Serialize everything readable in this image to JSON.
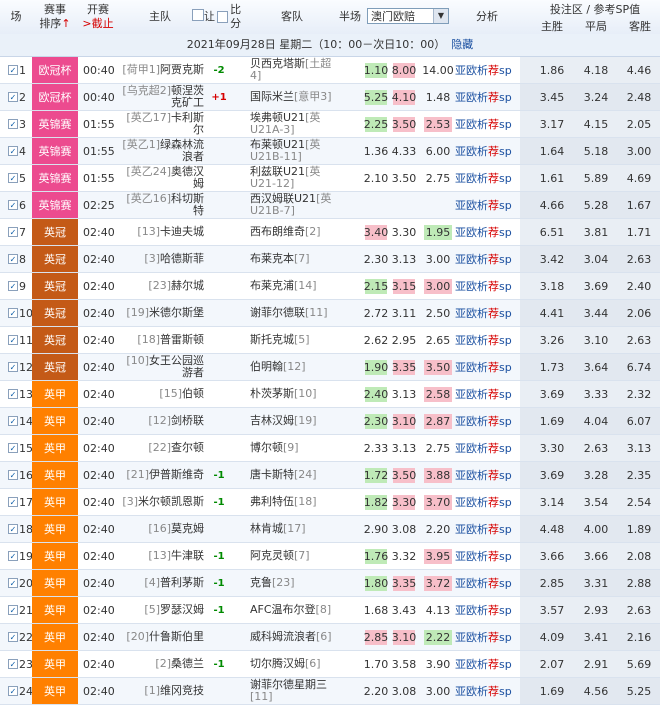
{
  "header": {
    "col_field": "场",
    "col_event": "赛事",
    "col_sort": "排序",
    "sort_arrow": "↑",
    "col_kick": "开赛",
    "col_cutoff": ">截止",
    "col_home": "主队",
    "col_hcap_let": "让",
    "col_hcap_score": "比分",
    "col_away": "客队",
    "col_half": "半场",
    "half_select": "澳门欧赔",
    "col_analysis": "分析",
    "sp_title": "投注区 / 参考SP值",
    "sp_home": "主胜",
    "sp_draw": "平局",
    "sp_away": "客胜"
  },
  "datebar": {
    "text": "2021年09月28日 星期二（10：00－次日10：00）",
    "hide_link": "隐藏"
  },
  "colors": {
    "ucl": "#ec4b8f",
    "champ": "#c45a17",
    "l1": "#ff8000",
    "odds_green": "#bfeab7",
    "odds_pink": "#f7bfc9"
  },
  "link_labels": {
    "yp": "亚",
    "op": "欧",
    "xi": "析",
    "tj": "荐",
    "sp": "sp"
  },
  "matches": [
    {
      "no": "1",
      "league": "欧冠杯",
      "lc": "ucl",
      "time": "00:40",
      "home_rank": "[荷甲1]",
      "home": "阿贾克斯",
      "hc": "-2",
      "hcc": "green",
      "away": "贝西克塔斯",
      "away_rank": "[土超4]",
      "o1": "1.10",
      "o1c": "g",
      "o2": "8.00",
      "o2c": "p",
      "o3": "14.00",
      "o3c": "",
      "sp1": "1.86",
      "sp2": "4.18",
      "sp3": "4.46"
    },
    {
      "no": "2",
      "league": "欧冠杯",
      "lc": "ucl",
      "time": "00:40",
      "home_rank": "[乌克超2]",
      "home": "顿涅茨克矿工",
      "hc": "+1",
      "hcc": "red",
      "away": "国际米兰",
      "away_rank": "[意甲3]",
      "o1": "5.25",
      "o1c": "g",
      "o2": "4.10",
      "o2c": "p",
      "o3": "1.48",
      "o3c": "",
      "sp1": "3.45",
      "sp2": "3.24",
      "sp3": "2.48"
    },
    {
      "no": "3",
      "league": "英锦赛",
      "lc": "ucl",
      "time": "01:55",
      "home_rank": "[英乙17]",
      "home": "卡利斯尔",
      "hc": "",
      "hcc": "",
      "away": "埃弗顿U21",
      "away_rank": "[英U21A-3]",
      "o1": "2.25",
      "o1c": "g",
      "o2": "3.50",
      "o2c": "p",
      "o3": "2.53",
      "o3c": "p",
      "sp1": "3.17",
      "sp2": "4.15",
      "sp3": "2.05"
    },
    {
      "no": "4",
      "league": "英锦赛",
      "lc": "ucl",
      "time": "01:55",
      "home_rank": "[英乙1]",
      "home": "绿森林流浪者",
      "hc": "",
      "hcc": "",
      "away": "布莱顿U21",
      "away_rank": "[英U21B-11]",
      "o1": "1.36",
      "o1c": "",
      "o2": "4.33",
      "o2c": "",
      "o3": "6.00",
      "o3c": "",
      "sp1": "1.64",
      "sp2": "5.18",
      "sp3": "3.00"
    },
    {
      "no": "5",
      "league": "英锦赛",
      "lc": "ucl",
      "time": "01:55",
      "home_rank": "[英乙24]",
      "home": "奥德汉姆",
      "hc": "",
      "hcc": "",
      "away": "利兹联U21",
      "away_rank": "[英U21-12]",
      "o1": "2.10",
      "o1c": "",
      "o2": "3.50",
      "o2c": "",
      "o3": "2.75",
      "o3c": "",
      "sp1": "1.61",
      "sp2": "5.89",
      "sp3": "4.69"
    },
    {
      "no": "6",
      "league": "英锦赛",
      "lc": "ucl",
      "time": "02:25",
      "home_rank": "[英乙16]",
      "home": "科切斯特",
      "hc": "",
      "hcc": "",
      "away": "西汉姆联U21",
      "away_rank": "[英U21B-7]",
      "o1": "",
      "o1c": "",
      "o2": "",
      "o2c": "",
      "o3": "",
      "o3c": "",
      "sp1": "4.66",
      "sp2": "5.28",
      "sp3": "1.67"
    },
    {
      "no": "7",
      "league": "英冠",
      "lc": "champ",
      "time": "02:40",
      "home_rank": "[13]",
      "home": "卡迪夫城",
      "hc": "",
      "hcc": "",
      "away": "西布朗维奇",
      "away_rank": "[2]",
      "o1": "3.40",
      "o1c": "p",
      "o2": "3.30",
      "o2c": "",
      "o3": "1.95",
      "o3c": "g",
      "sp1": "6.51",
      "sp2": "3.81",
      "sp3": "1.71"
    },
    {
      "no": "8",
      "league": "英冠",
      "lc": "champ",
      "time": "02:40",
      "home_rank": "[3]",
      "home": "哈德斯菲",
      "hc": "",
      "hcc": "",
      "away": "布莱克本",
      "away_rank": "[7]",
      "o1": "2.30",
      "o1c": "",
      "o2": "3.13",
      "o2c": "",
      "o3": "3.00",
      "o3c": "",
      "sp1": "3.42",
      "sp2": "3.04",
      "sp3": "2.63"
    },
    {
      "no": "9",
      "league": "英冠",
      "lc": "champ",
      "time": "02:40",
      "home_rank": "[23]",
      "home": "赫尔城",
      "hc": "",
      "hcc": "",
      "away": "布莱克浦",
      "away_rank": "[14]",
      "o1": "2.15",
      "o1c": "g",
      "o2": "3.15",
      "o2c": "p",
      "o3": "3.00",
      "o3c": "p",
      "sp1": "3.18",
      "sp2": "3.69",
      "sp3": "2.40"
    },
    {
      "no": "10",
      "league": "英冠",
      "lc": "champ",
      "time": "02:40",
      "home_rank": "[19]",
      "home": "米德尔斯堡",
      "hc": "",
      "hcc": "",
      "away": "谢菲尔德联",
      "away_rank": "[11]",
      "o1": "2.72",
      "o1c": "",
      "o2": "3.11",
      "o2c": "",
      "o3": "2.50",
      "o3c": "",
      "sp1": "4.41",
      "sp2": "3.44",
      "sp3": "2.06"
    },
    {
      "no": "11",
      "league": "英冠",
      "lc": "champ",
      "time": "02:40",
      "home_rank": "[18]",
      "home": "普雷斯顿",
      "hc": "",
      "hcc": "",
      "away": "斯托克城",
      "away_rank": "[5]",
      "o1": "2.62",
      "o1c": "",
      "o2": "2.95",
      "o2c": "",
      "o3": "2.65",
      "o3c": "",
      "sp1": "3.26",
      "sp2": "3.10",
      "sp3": "2.63"
    },
    {
      "no": "12",
      "league": "英冠",
      "lc": "champ",
      "time": "02:40",
      "home_rank": "[10]",
      "home": "女王公园巡游者",
      "hc": "",
      "hcc": "",
      "away": "伯明翰",
      "away_rank": "[12]",
      "o1": "1.90",
      "o1c": "g",
      "o2": "3.35",
      "o2c": "p",
      "o3": "3.50",
      "o3c": "p",
      "sp1": "1.73",
      "sp2": "3.64",
      "sp3": "6.74"
    },
    {
      "no": "13",
      "league": "英甲",
      "lc": "l1",
      "time": "02:40",
      "home_rank": "[15]",
      "home": "伯顿",
      "hc": "",
      "hcc": "",
      "away": "朴茨茅斯",
      "away_rank": "[10]",
      "o1": "2.40",
      "o1c": "g",
      "o2": "3.13",
      "o2c": "",
      "o3": "2.58",
      "o3c": "p",
      "sp1": "3.69",
      "sp2": "3.33",
      "sp3": "2.32"
    },
    {
      "no": "14",
      "league": "英甲",
      "lc": "l1",
      "time": "02:40",
      "home_rank": "[12]",
      "home": "剑桥联",
      "hc": "",
      "hcc": "",
      "away": "吉林汉姆",
      "away_rank": "[19]",
      "o1": "2.30",
      "o1c": "g",
      "o2": "3.10",
      "o2c": "p",
      "o3": "2.87",
      "o3c": "p",
      "sp1": "1.69",
      "sp2": "4.04",
      "sp3": "6.07"
    },
    {
      "no": "15",
      "league": "英甲",
      "lc": "l1",
      "time": "02:40",
      "home_rank": "[22]",
      "home": "查尔顿",
      "hc": "",
      "hcc": "",
      "away": "博尔顿",
      "away_rank": "[9]",
      "o1": "2.33",
      "o1c": "",
      "o2": "3.13",
      "o2c": "",
      "o3": "2.75",
      "o3c": "",
      "sp1": "3.30",
      "sp2": "2.63",
      "sp3": "3.13"
    },
    {
      "no": "16",
      "league": "英甲",
      "lc": "l1",
      "time": "02:40",
      "home_rank": "[21]",
      "home": "伊普斯维奇",
      "hc": "-1",
      "hcc": "green",
      "away": "唐卡斯特",
      "away_rank": "[24]",
      "o1": "1.72",
      "o1c": "g",
      "o2": "3.50",
      "o2c": "p",
      "o3": "3.88",
      "o3c": "p",
      "sp1": "3.69",
      "sp2": "3.28",
      "sp3": "2.35"
    },
    {
      "no": "17",
      "league": "英甲",
      "lc": "l1",
      "time": "02:40",
      "home_rank": "[3]",
      "home": "米尔顿凯恩斯",
      "hc": "-1",
      "hcc": "green",
      "away": "弗利特伍",
      "away_rank": "[18]",
      "o1": "1.82",
      "o1c": "g",
      "o2": "3.30",
      "o2c": "p",
      "o3": "3.70",
      "o3c": "p",
      "sp1": "3.14",
      "sp2": "3.54",
      "sp3": "2.54"
    },
    {
      "no": "18",
      "league": "英甲",
      "lc": "l1",
      "time": "02:40",
      "home_rank": "[16]",
      "home": "莫克姆",
      "hc": "",
      "hcc": "",
      "away": "林肯城",
      "away_rank": "[17]",
      "o1": "2.90",
      "o1c": "",
      "o2": "3.08",
      "o2c": "",
      "o3": "2.20",
      "o3c": "",
      "sp1": "4.48",
      "sp2": "4.00",
      "sp3": "1.89"
    },
    {
      "no": "19",
      "league": "英甲",
      "lc": "l1",
      "time": "02:40",
      "home_rank": "[13]",
      "home": "牛津联",
      "hc": "-1",
      "hcc": "green",
      "away": "阿克灵顿",
      "away_rank": "[7]",
      "o1": "1.76",
      "o1c": "g",
      "o2": "3.32",
      "o2c": "",
      "o3": "3.95",
      "o3c": "p",
      "sp1": "3.66",
      "sp2": "3.66",
      "sp3": "2.08"
    },
    {
      "no": "20",
      "league": "英甲",
      "lc": "l1",
      "time": "02:40",
      "home_rank": "[4]",
      "home": "普利茅斯",
      "hc": "-1",
      "hcc": "green",
      "away": "克鲁",
      "away_rank": "[23]",
      "o1": "1.80",
      "o1c": "g",
      "o2": "3.35",
      "o2c": "p",
      "o3": "3.72",
      "o3c": "p",
      "sp1": "2.85",
      "sp2": "3.31",
      "sp3": "2.88"
    },
    {
      "no": "21",
      "league": "英甲",
      "lc": "l1",
      "time": "02:40",
      "home_rank": "[5]",
      "home": "罗瑟汉姆",
      "hc": "-1",
      "hcc": "green",
      "away": "AFC温布尔登",
      "away_rank": "[8]",
      "o1": "1.68",
      "o1c": "",
      "o2": "3.43",
      "o2c": "",
      "o3": "4.13",
      "o3c": "",
      "sp1": "3.57",
      "sp2": "2.93",
      "sp3": "2.63"
    },
    {
      "no": "22",
      "league": "英甲",
      "lc": "l1",
      "time": "02:40",
      "home_rank": "[20]",
      "home": "什鲁斯伯里",
      "hc": "",
      "hcc": "",
      "away": "威科姆流浪者",
      "away_rank": "[6]",
      "o1": "2.85",
      "o1c": "p",
      "o2": "3.10",
      "o2c": "p",
      "o3": "2.22",
      "o3c": "g",
      "sp1": "4.09",
      "sp2": "3.41",
      "sp3": "2.16"
    },
    {
      "no": "23",
      "league": "英甲",
      "lc": "l1",
      "time": "02:40",
      "home_rank": "[2]",
      "home": "桑德兰",
      "hc": "-1",
      "hcc": "green",
      "away": "切尔腾汉姆",
      "away_rank": "[6]",
      "o1": "1.70",
      "o1c": "",
      "o2": "3.58",
      "o2c": "",
      "o3": "3.90",
      "o3c": "",
      "sp1": "2.07",
      "sp2": "2.91",
      "sp3": "5.69"
    },
    {
      "no": "24",
      "league": "英甲",
      "lc": "l1",
      "time": "02:40",
      "home_rank": "[1]",
      "home": "维冈竞技",
      "hc": "",
      "hcc": "",
      "away": "谢菲尔德星期三",
      "away_rank": "[11]",
      "o1": "2.20",
      "o1c": "",
      "o2": "3.08",
      "o2c": "",
      "o3": "3.00",
      "o3c": "",
      "sp1": "1.69",
      "sp2": "4.56",
      "sp3": "5.25"
    }
  ]
}
